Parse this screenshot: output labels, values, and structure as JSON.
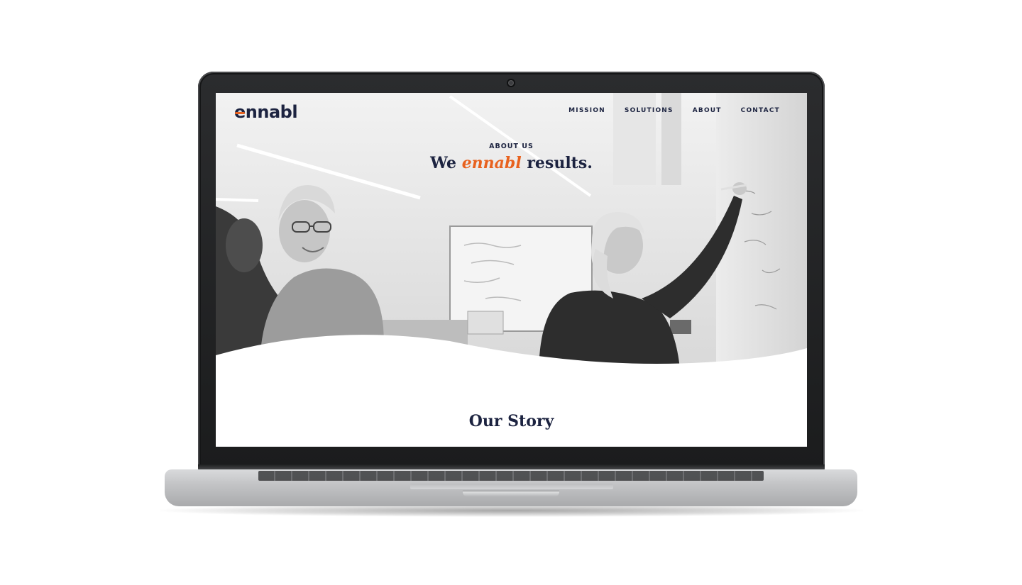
{
  "site": {
    "logo_text": "ennabl",
    "brand_colors": {
      "navy": "#1c2340",
      "orange": "#e8621f"
    }
  },
  "nav": {
    "items": [
      {
        "label": "MISSION"
      },
      {
        "label": "SOLUTIONS"
      },
      {
        "label": "ABOUT"
      },
      {
        "label": "CONTACT"
      }
    ]
  },
  "hero": {
    "eyebrow": "ABOUT US",
    "headline_pre": "We",
    "headline_accent": "ennabl",
    "headline_post": "results.",
    "image": "black-and-white office photo of two people at a whiteboard"
  },
  "story": {
    "title": "Our Story"
  },
  "device": {
    "type": "laptop-mockup",
    "icons": [
      "camera-icon"
    ]
  }
}
